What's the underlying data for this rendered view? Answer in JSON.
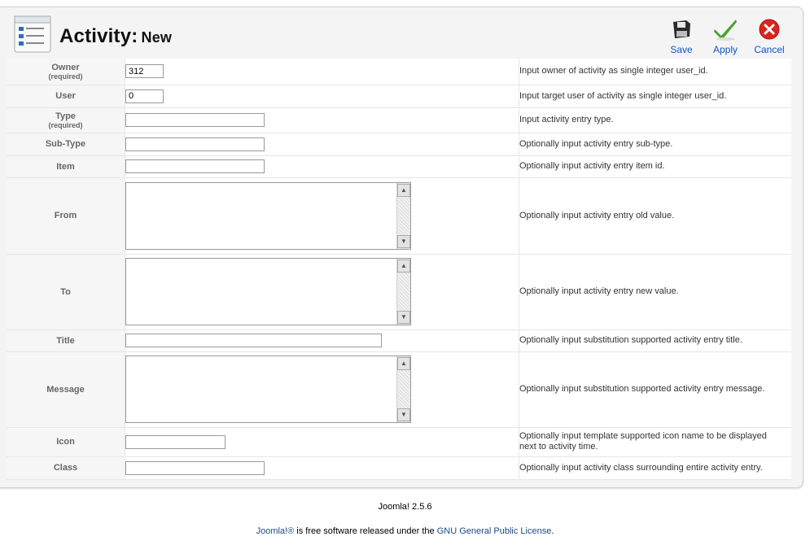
{
  "header": {
    "title": "Activity:",
    "subtitle": "New"
  },
  "toolbar": {
    "save_label": "Save",
    "apply_label": "Apply",
    "cancel_label": "Cancel"
  },
  "required_label": "(required)",
  "fields": {
    "owner": {
      "label": "Owner",
      "value": "312",
      "desc": "Input owner of activity as single integer user_id."
    },
    "user": {
      "label": "User",
      "value": "0",
      "desc": "Input target user of activity as single integer user_id."
    },
    "type": {
      "label": "Type",
      "value": "",
      "desc": "Input activity entry type."
    },
    "subtype": {
      "label": "Sub-Type",
      "value": "",
      "desc": "Optionally input activity entry sub-type."
    },
    "item": {
      "label": "Item",
      "value": "",
      "desc": "Optionally input activity entry item id."
    },
    "from": {
      "label": "From",
      "value": "",
      "desc": "Optionally input activity entry old value."
    },
    "to": {
      "label": "To",
      "value": "",
      "desc": "Optionally input activity entry new value."
    },
    "title": {
      "label": "Title",
      "value": "",
      "desc": "Optionally input substitution supported activity entry title."
    },
    "message": {
      "label": "Message",
      "value": "",
      "desc": "Optionally input substitution supported activity entry message."
    },
    "icon": {
      "label": "Icon",
      "value": "",
      "desc": "Optionally input template supported icon name to be displayed next to activity time."
    },
    "class": {
      "label": "Class",
      "value": "",
      "desc": "Optionally input activity class surrounding entire activity entry."
    }
  },
  "footer": {
    "version": "Joomla! 2.5.6",
    "joomla_link": "Joomla!®",
    "text_middle": " is free software released under the ",
    "license_link": "GNU General Public License",
    "text_end": "."
  },
  "colors": {
    "link": "#0b55c4",
    "apply_check": "#4aa32a",
    "cancel_red": "#d9261c"
  },
  "icons": {
    "header": "article-list-icon",
    "save": "floppy-disk-icon",
    "apply": "checkmark-icon",
    "cancel": "cancel-x-icon"
  }
}
